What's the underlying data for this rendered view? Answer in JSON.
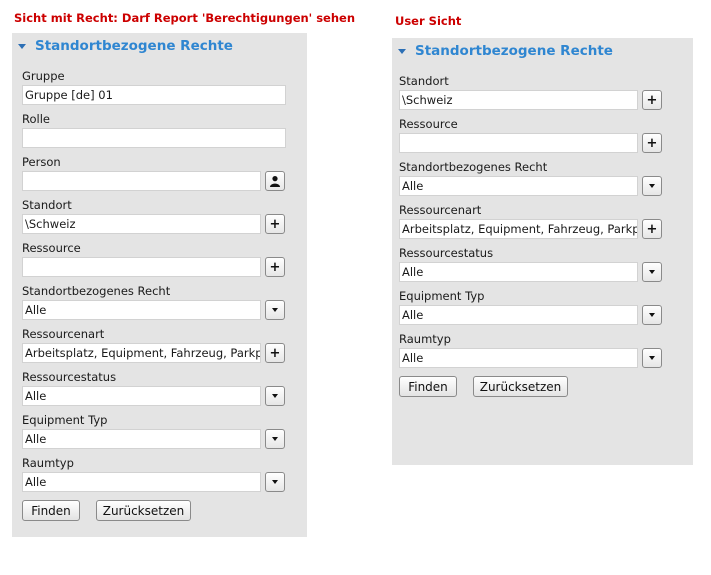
{
  "left": {
    "caption": "Sicht mit Recht: Darf Report 'Berechtigungen' sehen",
    "panel_title": "Standortbezogene Rechte",
    "fields": {
      "gruppe": {
        "label": "Gruppe",
        "value": "Gruppe [de] 01"
      },
      "rolle": {
        "label": "Rolle",
        "value": ""
      },
      "person": {
        "label": "Person",
        "value": ""
      },
      "standort": {
        "label": "Standort",
        "value": "\\Schweiz"
      },
      "ressource": {
        "label": "Ressource",
        "value": ""
      },
      "recht": {
        "label": "Standortbezogenes Recht",
        "value": "Alle"
      },
      "ressourcenart": {
        "label": "Ressourcenart",
        "value": "Arbeitsplatz, Equipment, Fahrzeug, Parkplatz,"
      },
      "ressourcestatus": {
        "label": "Ressourcestatus",
        "value": "Alle"
      },
      "equipment_typ": {
        "label": "Equipment Typ",
        "value": "Alle"
      },
      "raumtyp": {
        "label": "Raumtyp",
        "value": "Alle"
      }
    },
    "buttons": {
      "find": "Finden",
      "reset": "Zurücksetzen"
    }
  },
  "right": {
    "caption": "User Sicht",
    "panel_title": "Standortbezogene Rechte",
    "fields": {
      "standort": {
        "label": "Standort",
        "value": "\\Schweiz"
      },
      "ressource": {
        "label": "Ressource",
        "value": ""
      },
      "recht": {
        "label": "Standortbezogenes Recht",
        "value": "Alle"
      },
      "ressourcenart": {
        "label": "Ressourcenart",
        "value": "Arbeitsplatz, Equipment, Fahrzeug, Parkplatz,"
      },
      "ressourcestatus": {
        "label": "Ressourcestatus",
        "value": "Alle"
      },
      "equipment_typ": {
        "label": "Equipment Typ",
        "value": "Alle"
      },
      "raumtyp": {
        "label": "Raumtyp",
        "value": "Alle"
      }
    },
    "buttons": {
      "find": "Finden",
      "reset": "Zurücksetzen"
    }
  },
  "icons": {
    "plus": "+",
    "person": "person-icon",
    "dropdown": "chevron-down-icon"
  }
}
